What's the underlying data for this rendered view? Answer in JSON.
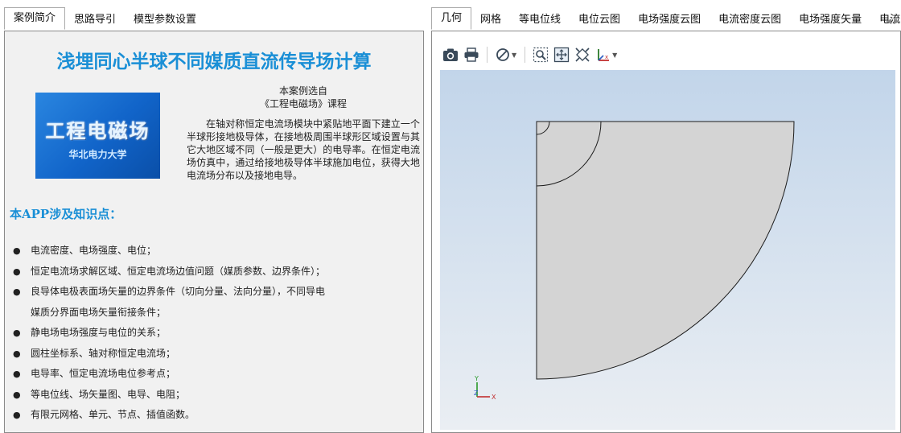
{
  "left_tabs": [
    {
      "label": "案例简介",
      "active": true
    },
    {
      "label": "思路导引",
      "active": false
    },
    {
      "label": "模型参数设置",
      "active": false
    }
  ],
  "right_tabs": [
    {
      "label": "几何",
      "active": true
    },
    {
      "label": "网格",
      "active": false
    },
    {
      "label": "等电位线",
      "active": false
    },
    {
      "label": "电位云图",
      "active": false
    },
    {
      "label": "电场强度云图",
      "active": false
    },
    {
      "label": "电流密度云图",
      "active": false
    },
    {
      "label": "电场强度矢量",
      "active": false
    },
    {
      "label": "电流",
      "active": false
    }
  ],
  "intro": {
    "title": "浅埋同心半球不同媒质直流传导场计算",
    "logo_text": "工程电磁场",
    "logo_sub": "华北电力大学",
    "source_line1": "本案例选自",
    "source_line2": "《工程电磁场》课程",
    "paragraph": "在轴对称恒定电流场模块中紧贴地平面下建立一个半球形接地极导体，在接地极周围半球形区域设置与其它大地区域不同（一般是更大）的电导率。在恒定电流场仿真中，通过给接地极导体半球施加电位，获得大地电流场分布以及接地电导。",
    "section_title": "本APP涉及知识点：",
    "bullets": [
      {
        "text": "电流密度、电场强度、电位；",
        "cont": ""
      },
      {
        "text": "恒定电流场求解区域、恒定电流场边值问题（媒质参数、边界条件）；",
        "cont": ""
      },
      {
        "text": "良导体电极表面场矢量的边界条件（切向分量、法向分量），不同导电",
        "cont": "媒质分界面电场矢量衔接条件；"
      },
      {
        "text": "静电场电场强度与电位的关系；",
        "cont": ""
      },
      {
        "text": "圆柱坐标系、轴对称恒定电流场；",
        "cont": ""
      },
      {
        "text": "电导率、恒定电流场电位参考点；",
        "cont": ""
      },
      {
        "text": "等电位线、场矢量图、电导、电阻；",
        "cont": ""
      },
      {
        "text": "有限元网格、单元、节点、插值函数。",
        "cont": ""
      }
    ]
  },
  "toolbar": {
    "icons": [
      "camera-icon",
      "print-icon",
      "clear-icon",
      "zoom-box-icon",
      "zoom-extents-icon",
      "fit-icon",
      "axes-icon"
    ]
  },
  "axis_triad": {
    "y": "Y",
    "z": "Z",
    "x": "X"
  },
  "colors": {
    "accent": "#1a8fd6",
    "geometry_fill": "#d4d4d4"
  }
}
